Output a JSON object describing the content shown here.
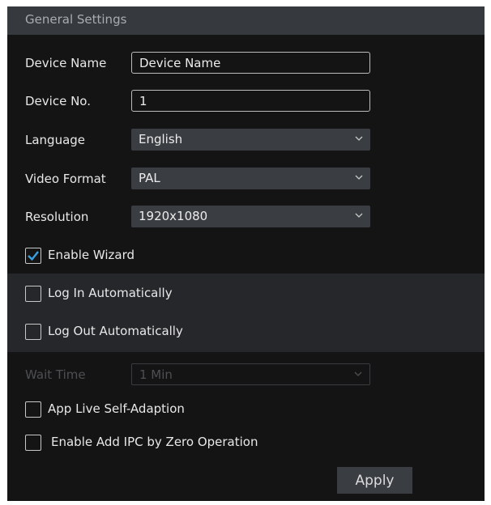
{
  "header": {
    "title": "General Settings"
  },
  "fields": {
    "device_name": {
      "label": "Device Name",
      "value": "Device Name"
    },
    "device_no": {
      "label": "Device No.",
      "value": "1"
    },
    "language": {
      "label": "Language",
      "value": "English"
    },
    "video_format": {
      "label": "Video Format",
      "value": "PAL"
    },
    "resolution": {
      "label": "Resolution",
      "value": "1920x1080"
    },
    "wait_time": {
      "label": "Wait Time",
      "value": "1 Min",
      "disabled": true
    }
  },
  "checkboxes": {
    "enable_wizard": {
      "label": "Enable Wizard",
      "checked": true
    },
    "log_in_auto": {
      "label": "Log In Automatically",
      "checked": false
    },
    "log_out_auto": {
      "label": "Log Out Automatically",
      "checked": false
    },
    "app_live": {
      "label": "App Live Self-Adaption",
      "checked": false
    },
    "zero_op": {
      "label": "Enable Add IPC by Zero Operation",
      "checked": false
    }
  },
  "buttons": {
    "apply": "Apply"
  },
  "colors": {
    "panel_bg": "#141414",
    "header_bg": "#36393e",
    "select_bg": "#3a3d42",
    "checkmark": "#3aa0e0"
  },
  "icons": {
    "dropdown": "chevron-down-icon",
    "check": "checkmark-icon"
  }
}
